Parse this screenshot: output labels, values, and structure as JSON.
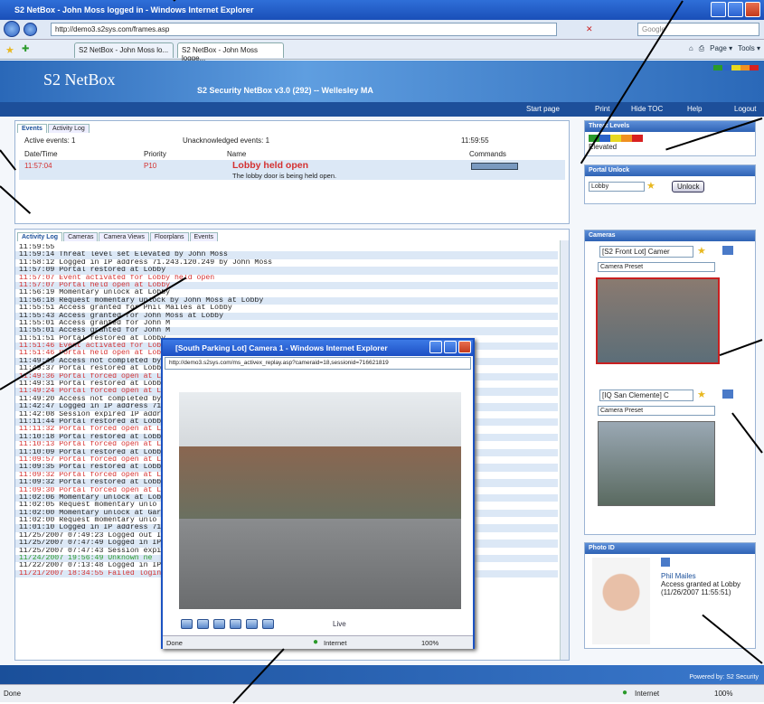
{
  "window": {
    "title": "S2 NetBox - John Moss logged in - Windows Internet Explorer"
  },
  "browser": {
    "url": "http://demo3.s2sys.com/frames.asp",
    "search_placeholder": "Google",
    "tabs": [
      "S2 NetBox - John Moss lo...",
      "S2 NetBox - John Moss logge..."
    ],
    "tools": [
      "Page ▾",
      "Tools ▾"
    ]
  },
  "banner": {
    "logo": "S2 NetBox",
    "version": "S2 Security NetBox v3.0 (292) -- Wellesley MA",
    "threat_mini": "Elevated"
  },
  "nav": {
    "items": [
      "Start page",
      "Print",
      "Hide TOC",
      "Help",
      "Logout"
    ]
  },
  "events_panel": {
    "tabs": [
      "Events",
      "Activity Log"
    ],
    "active_events": "Active events: 1",
    "unacknowledged": "Unacknowledged events: 1",
    "time": "11:59:55",
    "columns": [
      "Date/Time",
      "Priority",
      "Name",
      "Commands"
    ],
    "row": {
      "time": "11:57:04",
      "priority": "P10",
      "name": "Lobby held open",
      "desc": "The lobby door is being held open."
    }
  },
  "log_panel": {
    "tabs": [
      "Activity Log",
      "Cameras",
      "Camera Views",
      "Floorplans",
      "Events"
    ],
    "lines": [
      {
        "t": "11:59:55",
        "c": ""
      },
      {
        "t": "11:59:14 Threat level set Elevated by John Moss",
        "c": ""
      },
      {
        "t": "11:58:12 Logged in IP address 71.243.120.249 by John Moss",
        "c": ""
      },
      {
        "t": "11:57:09 Portal restored at Lobby",
        "c": ""
      },
      {
        "t": "11:57:07 Event activated for Lobby held open",
        "c": "red"
      },
      {
        "t": "11:57:07 Portal held open at Lobby",
        "c": "red"
      },
      {
        "t": "11:56:19 Momentary unlock at Lobby",
        "c": ""
      },
      {
        "t": "11:56:18 Request momentary unlock by John Moss at Lobby",
        "c": ""
      },
      {
        "t": "11:55:51 Access granted for Phil Mailes at Lobby",
        "c": ""
      },
      {
        "t": "11:55:43 Access granted for John Moss at Lobby",
        "c": ""
      },
      {
        "t": "11:55:01 Access granted for John M",
        "c": ""
      },
      {
        "t": "11:55:01 Access granted for John M",
        "c": ""
      },
      {
        "t": "11:51:51 Portal restored at Lobby",
        "c": ""
      },
      {
        "t": "11:51:46 Event activated for Lobby",
        "c": "red"
      },
      {
        "t": "11:51:46 Portal held open at Lobby",
        "c": "red"
      },
      {
        "t": "11:49:49 Access not completed by",
        "c": ""
      },
      {
        "t": "11:49:37 Portal restored at Lobby",
        "c": ""
      },
      {
        "t": "11:49:36 Portal forced open at Lob",
        "c": "red"
      },
      {
        "t": "11:49:31 Portal restored at Lobby",
        "c": ""
      },
      {
        "t": "11:49:24 Portal forced open at Lob",
        "c": "red"
      },
      {
        "t": "11:49:20 Access not completed by",
        "c": ""
      },
      {
        "t": "11:42:47 Logged in IP address 71.",
        "c": ""
      },
      {
        "t": "11:42:08 Session expired IP addre",
        "c": ""
      },
      {
        "t": "11:11:44 Portal restored at Lobby",
        "c": ""
      },
      {
        "t": "11:11:32 Portal forced open at Lob",
        "c": "red"
      },
      {
        "t": "11:10:18 Portal restored at Lobby",
        "c": ""
      },
      {
        "t": "11:10:13 Portal forced open at Lob",
        "c": "red"
      },
      {
        "t": "11:10:09 Portal restored at Lobby",
        "c": ""
      },
      {
        "t": "11:09:57 Portal forced open at Lob",
        "c": "red"
      },
      {
        "t": "11:09:35 Portal restored at Lobby",
        "c": ""
      },
      {
        "t": "11:09:32 Portal forced open at Lob",
        "c": "red"
      },
      {
        "t": "11:09:32 Portal restored at Lobby",
        "c": ""
      },
      {
        "t": "11:09:30 Portal forced open at Lob",
        "c": "red"
      },
      {
        "t": "11:02:06 Momentary unlock at Lob",
        "c": ""
      },
      {
        "t": "11:02:05 Request momentary unlo",
        "c": ""
      },
      {
        "t": "11:02:00 Momentary unlock at Gar",
        "c": ""
      },
      {
        "t": "11:02:00 Request momentary unlo",
        "c": ""
      },
      {
        "t": "11:01:10 Logged in IP address 71.",
        "c": ""
      },
      {
        "t": "11/25/2007 07:49:23 Logged out I",
        "c": ""
      },
      {
        "t": "11/25/2007 07:47:49 Logged in IP",
        "c": ""
      },
      {
        "t": "11/25/2007 07:47:43 Session expi",
        "c": ""
      },
      {
        "t": "11/24/2007 19:56:49 Unknown ne",
        "c": "grn"
      },
      {
        "t": "11/22/2007 07:13:48 Logged in IP",
        "c": ""
      },
      {
        "t": "11/21/2007 18:34:55 Failed login IP address 12.110.136.92 (username gmyatt)",
        "c": "red"
      }
    ]
  },
  "threat": {
    "title": "Threat Levels",
    "level": "Elevated",
    "colors": [
      "#2a9a2a",
      "#2a62c8",
      "#e8d820",
      "#f09020",
      "#d82020"
    ]
  },
  "portal": {
    "title": "Portal Unlock",
    "portal": "Lobby",
    "button": "Unlock"
  },
  "cameras": {
    "title": "Cameras",
    "cam1": "[S2 Front Lot] Camer",
    "cam2": "[IQ San Clemente] C",
    "preset": "Camera Preset"
  },
  "photo": {
    "title": "Photo ID",
    "name": "Phil Mailes",
    "desc": "Access granted at Lobby",
    "time": "(11/26/2007 11:55:51)"
  },
  "popup": {
    "title": "[South Parking Lot] Camera 1 - Windows Internet Explorer",
    "url": "http://demo3.s2sys.com/ms_activex_replay.asp?cameraid=18,sessionid=716621819",
    "live": "Live",
    "status": "Done",
    "zone": "Internet",
    "zoom": "100%"
  },
  "footer": {
    "powered": "Powered by: S2 Security"
  },
  "statusbar": {
    "left": "Done",
    "zone": "Internet",
    "zoom": "100%"
  }
}
